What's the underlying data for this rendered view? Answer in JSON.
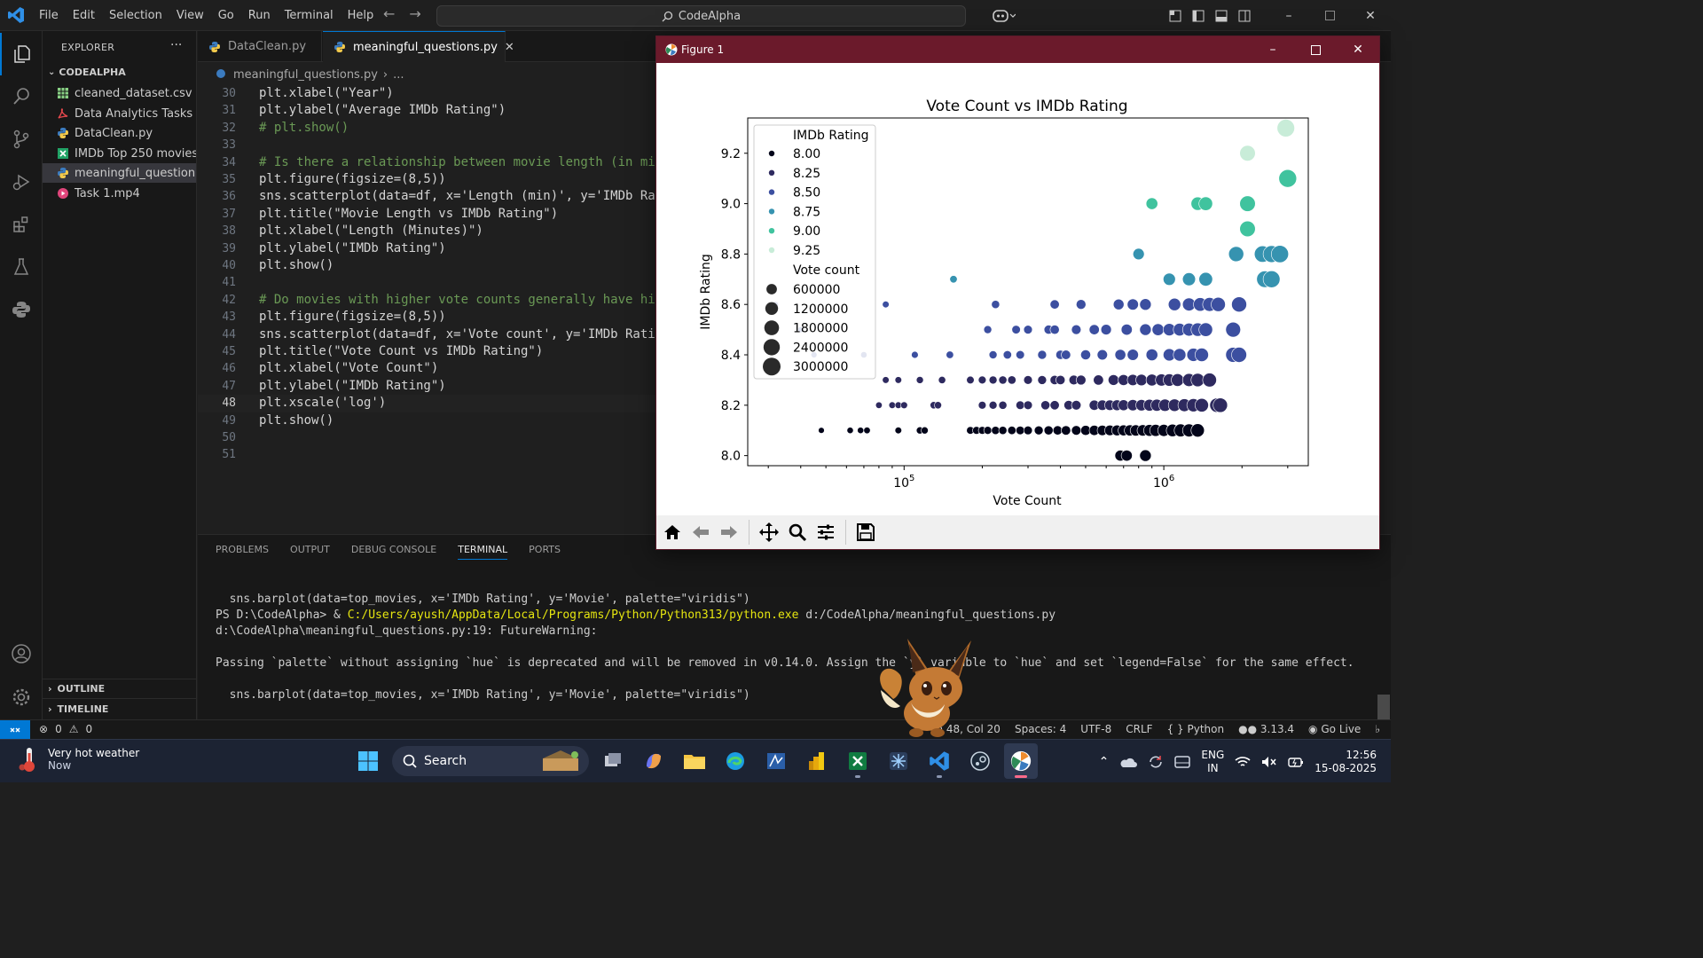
{
  "titlebar": {
    "menu": [
      "File",
      "Edit",
      "Selection",
      "View",
      "Go",
      "Run",
      "Terminal",
      "Help"
    ],
    "search_text": "CodeAlpha"
  },
  "sidebar": {
    "header": "EXPLORER",
    "folder": "CODEALPHA",
    "files": [
      {
        "name": "cleaned_dataset.csv",
        "icon": "csv-icon"
      },
      {
        "name": "Data Analytics Tasks ...",
        "icon": "pdf-icon"
      },
      {
        "name": "DataClean.py",
        "icon": "python-icon"
      },
      {
        "name": "IMDb Top 250 movies...",
        "icon": "excel-icon"
      },
      {
        "name": "meaningful_question...",
        "icon": "python-icon"
      },
      {
        "name": "Task 1.mp4",
        "icon": "video-icon"
      }
    ],
    "outline": "OUTLINE",
    "timeline": "TIMELINE"
  },
  "tabs": [
    {
      "label": "DataClean.py"
    },
    {
      "label": "meaningful_questions.py"
    }
  ],
  "breadcrumb": {
    "file": "meaningful_questions.py",
    "more": "..."
  },
  "editor": {
    "lines": [
      {
        "n": "30",
        "code": "plt.xlabel(\"Year\")"
      },
      {
        "n": "31",
        "code": "plt.ylabel(\"Average IMDb Rating\")"
      },
      {
        "n": "32",
        "code": "# plt.show()"
      },
      {
        "n": "33",
        "code": ""
      },
      {
        "n": "34",
        "code": "# Is there a relationship between movie length (in minute"
      },
      {
        "n": "35",
        "code": "plt.figure(figsize=(8,5))"
      },
      {
        "n": "36",
        "code": "sns.scatterplot(data=df, x='Length (min)', y='IMDb Rating"
      },
      {
        "n": "37",
        "code": "plt.title(\"Movie Length vs IMDb Rating\")"
      },
      {
        "n": "38",
        "code": "plt.xlabel(\"Length (Minutes)\")"
      },
      {
        "n": "39",
        "code": "plt.ylabel(\"IMDb Rating\")"
      },
      {
        "n": "40",
        "code": "plt.show()"
      },
      {
        "n": "41",
        "code": ""
      },
      {
        "n": "42",
        "code": "# Do movies with higher vote counts generally have higher"
      },
      {
        "n": "43",
        "code": "plt.figure(figsize=(8,5))"
      },
      {
        "n": "44",
        "code": "sns.scatterplot(data=df, x='Vote count', y='IMDb Rating',"
      },
      {
        "n": "45",
        "code": "plt.title(\"Vote Count vs IMDb Rating\")"
      },
      {
        "n": "46",
        "code": "plt.xlabel(\"Vote Count\")"
      },
      {
        "n": "47",
        "code": "plt.ylabel(\"IMDb Rating\")"
      },
      {
        "n": "48",
        "code": "plt.xscale('log')"
      },
      {
        "n": "49",
        "code": "plt.show()"
      },
      {
        "n": "50",
        "code": ""
      },
      {
        "n": "51",
        "code": ""
      }
    ]
  },
  "panel": {
    "tabs": [
      "PROBLEMS",
      "OUTPUT",
      "DEBUG CONSOLE",
      "TERMINAL",
      "PORTS"
    ],
    "active_tab": "TERMINAL",
    "terminal": [
      {
        "plain": "  sns.barplot(data=top_movies, x='IMDb Rating', y='Movie', palette=\"viridis\")",
        "hl": "",
        "rest": ""
      },
      {
        "plain": "PS D:\\CodeAlpha> & ",
        "hl": "C:/Users/ayush/AppData/Local/Programs/Python/Python313/python.exe",
        "rest": " d:/CodeAlpha/meaningful_questions.py"
      },
      {
        "plain": "d:\\CodeAlpha\\meaningful_questions.py:19: FutureWarning:",
        "hl": "",
        "rest": ""
      },
      {
        "plain": "",
        "hl": "",
        "rest": ""
      },
      {
        "plain": "Passing `palette` without assigning `hue` is deprecated and will be removed in v0.14.0. Assign the `y` variable to `hue` and set `legend=False` for the same effect.",
        "hl": "",
        "rest": ""
      },
      {
        "plain": "",
        "hl": "",
        "rest": ""
      },
      {
        "plain": "  sns.barplot(data=top_movies, x='IMDb Rating', y='Movie', palette=\"viridis\")",
        "hl": "",
        "rest": ""
      }
    ]
  },
  "statusbar": {
    "errors": "0",
    "warnings": "0",
    "position": "Ln 48, Col 20",
    "spaces": "Spaces: 4",
    "encoding": "UTF-8",
    "eol": "CRLF",
    "language": "Python",
    "version": "3.13.4",
    "golive": "Go Live"
  },
  "figure_window": {
    "title": "Figure 1"
  },
  "chart_data": {
    "type": "scatter",
    "title": "Vote Count vs IMDb Rating",
    "xlabel": "Vote Count",
    "ylabel": "IMDb Rating",
    "xscale": "log",
    "xlim": [
      25000,
      3600000
    ],
    "ylim": [
      7.96,
      9.34
    ],
    "xticks": [
      {
        "value": 100000,
        "base": "10",
        "exp": "5"
      },
      {
        "value": 1000000,
        "base": "10",
        "exp": "6"
      }
    ],
    "yticks": [
      8.0,
      8.2,
      8.4,
      8.6,
      8.8,
      9.0,
      9.2
    ],
    "legend": {
      "placement": "upper-left",
      "hue_title": "IMDb Rating",
      "hue_items": [
        {
          "label": "8.00",
          "color": "#03051a"
        },
        {
          "label": "8.25",
          "color": "#2e2a5f"
        },
        {
          "label": "8.50",
          "color": "#3c4fa0"
        },
        {
          "label": "8.75",
          "color": "#3693b0"
        },
        {
          "label": "9.00",
          "color": "#40c39e"
        },
        {
          "label": "9.25",
          "color": "#c8ecd8"
        }
      ],
      "size_title": "Vote count",
      "size_items": [
        "600000",
        "1200000",
        "1800000",
        "2400000",
        "3000000"
      ]
    },
    "points": [
      [
        48000,
        8.1
      ],
      [
        62000,
        8.1
      ],
      [
        68000,
        8.1
      ],
      [
        72000,
        8.1
      ],
      [
        95000,
        8.1
      ],
      [
        115000,
        8.1
      ],
      [
        120000,
        8.1
      ],
      [
        180000,
        8.1
      ],
      [
        190000,
        8.1
      ],
      [
        200000,
        8.1
      ],
      [
        210000,
        8.1
      ],
      [
        225000,
        8.1
      ],
      [
        240000,
        8.1
      ],
      [
        260000,
        8.1
      ],
      [
        280000,
        8.1
      ],
      [
        300000,
        8.1
      ],
      [
        330000,
        8.1
      ],
      [
        360000,
        8.1
      ],
      [
        390000,
        8.1
      ],
      [
        420000,
        8.1
      ],
      [
        460000,
        8.1
      ],
      [
        500000,
        8.1
      ],
      [
        540000,
        8.1
      ],
      [
        580000,
        8.1
      ],
      [
        620000,
        8.1
      ],
      [
        660000,
        8.1
      ],
      [
        700000,
        8.1
      ],
      [
        740000,
        8.1
      ],
      [
        780000,
        8.1
      ],
      [
        830000,
        8.1
      ],
      [
        880000,
        8.1
      ],
      [
        930000,
        8.1
      ],
      [
        1000000,
        8.1
      ],
      [
        1080000,
        8.1
      ],
      [
        1160000,
        8.1
      ],
      [
        1250000,
        8.1
      ],
      [
        1350000,
        8.1
      ],
      [
        80000,
        8.2
      ],
      [
        90000,
        8.2
      ],
      [
        95000,
        8.2
      ],
      [
        100000,
        8.2
      ],
      [
        130000,
        8.2
      ],
      [
        135000,
        8.2
      ],
      [
        200000,
        8.2
      ],
      [
        220000,
        8.2
      ],
      [
        240000,
        8.2
      ],
      [
        280000,
        8.2
      ],
      [
        300000,
        8.2
      ],
      [
        350000,
        8.2
      ],
      [
        380000,
        8.2
      ],
      [
        430000,
        8.2
      ],
      [
        460000,
        8.2
      ],
      [
        540000,
        8.2
      ],
      [
        580000,
        8.2
      ],
      [
        620000,
        8.2
      ],
      [
        660000,
        8.2
      ],
      [
        700000,
        8.2
      ],
      [
        760000,
        8.2
      ],
      [
        820000,
        8.2
      ],
      [
        880000,
        8.2
      ],
      [
        940000,
        8.2
      ],
      [
        1010000,
        8.2
      ],
      [
        1100000,
        8.2
      ],
      [
        1200000,
        8.2
      ],
      [
        1300000,
        8.2
      ],
      [
        1400000,
        8.2
      ],
      [
        1600000,
        8.2
      ],
      [
        1650000,
        8.2
      ],
      [
        85000,
        8.3
      ],
      [
        95000,
        8.3
      ],
      [
        115000,
        8.3
      ],
      [
        140000,
        8.3
      ],
      [
        180000,
        8.3
      ],
      [
        200000,
        8.3
      ],
      [
        220000,
        8.3
      ],
      [
        240000,
        8.3
      ],
      [
        260000,
        8.3
      ],
      [
        300000,
        8.3
      ],
      [
        340000,
        8.3
      ],
      [
        380000,
        8.3
      ],
      [
        400000,
        8.3
      ],
      [
        450000,
        8.3
      ],
      [
        480000,
        8.3
      ],
      [
        560000,
        8.3
      ],
      [
        640000,
        8.3
      ],
      [
        700000,
        8.3
      ],
      [
        760000,
        8.3
      ],
      [
        820000,
        8.3
      ],
      [
        900000,
        8.3
      ],
      [
        980000,
        8.3
      ],
      [
        1050000,
        8.3
      ],
      [
        1130000,
        8.3
      ],
      [
        1250000,
        8.3
      ],
      [
        1350000,
        8.3
      ],
      [
        1500000,
        8.3
      ],
      [
        45000,
        8.4
      ],
      [
        70000,
        8.4
      ],
      [
        110000,
        8.4
      ],
      [
        150000,
        8.4
      ],
      [
        220000,
        8.4
      ],
      [
        250000,
        8.4
      ],
      [
        280000,
        8.4
      ],
      [
        340000,
        8.4
      ],
      [
        400000,
        8.4
      ],
      [
        420000,
        8.4
      ],
      [
        500000,
        8.4
      ],
      [
        580000,
        8.4
      ],
      [
        680000,
        8.4
      ],
      [
        760000,
        8.4
      ],
      [
        900000,
        8.4
      ],
      [
        1050000,
        8.4
      ],
      [
        1150000,
        8.4
      ],
      [
        1300000,
        8.4
      ],
      [
        1400000,
        8.4
      ],
      [
        1850000,
        8.4
      ],
      [
        1950000,
        8.4
      ],
      [
        40000,
        8.5
      ],
      [
        210000,
        8.5
      ],
      [
        270000,
        8.5
      ],
      [
        300000,
        8.5
      ],
      [
        360000,
        8.5
      ],
      [
        380000,
        8.5
      ],
      [
        460000,
        8.5
      ],
      [
        540000,
        8.5
      ],
      [
        600000,
        8.5
      ],
      [
        720000,
        8.5
      ],
      [
        850000,
        8.5
      ],
      [
        950000,
        8.5
      ],
      [
        1050000,
        8.5
      ],
      [
        1150000,
        8.5
      ],
      [
        1250000,
        8.5
      ],
      [
        1350000,
        8.5
      ],
      [
        1450000,
        8.5
      ],
      [
        1850000,
        8.5
      ],
      [
        32000,
        8.6
      ],
      [
        85000,
        8.6
      ],
      [
        225000,
        8.6
      ],
      [
        380000,
        8.6
      ],
      [
        480000,
        8.6
      ],
      [
        670000,
        8.6
      ],
      [
        760000,
        8.6
      ],
      [
        850000,
        8.6
      ],
      [
        1100000,
        8.6
      ],
      [
        1250000,
        8.6
      ],
      [
        1380000,
        8.6
      ],
      [
        1500000,
        8.6
      ],
      [
        1620000,
        8.6
      ],
      [
        1950000,
        8.6
      ],
      [
        155000,
        8.7
      ],
      [
        1050000,
        8.7
      ],
      [
        1250000,
        8.7
      ],
      [
        1450000,
        8.7
      ],
      [
        2450000,
        8.7
      ],
      [
        2600000,
        8.7
      ],
      [
        800000,
        8.8
      ],
      [
        1900000,
        8.8
      ],
      [
        2400000,
        8.8
      ],
      [
        2600000,
        8.8
      ],
      [
        2800000,
        8.8
      ],
      [
        900000,
        9.0
      ],
      [
        1350000,
        9.0
      ],
      [
        1450000,
        9.0
      ],
      [
        2100000,
        9.0
      ],
      [
        2100000,
        8.9
      ],
      [
        2100000,
        9.2
      ],
      [
        3000000,
        9.1
      ],
      [
        2950000,
        9.3
      ],
      [
        680000,
        8.0
      ],
      [
        720000,
        8.0
      ],
      [
        850000,
        8.0
      ]
    ]
  },
  "taskbar": {
    "weather_title": "Very hot weather",
    "weather_sub": "Now",
    "search": "Search",
    "lang1": "ENG",
    "lang2": "IN",
    "time": "12:56",
    "date": "15-08-2025"
  },
  "colors": {
    "accent": "#0078d4",
    "figure_titlebar": "#6b1a2b",
    "editor_bg": "#1f1f1f"
  }
}
